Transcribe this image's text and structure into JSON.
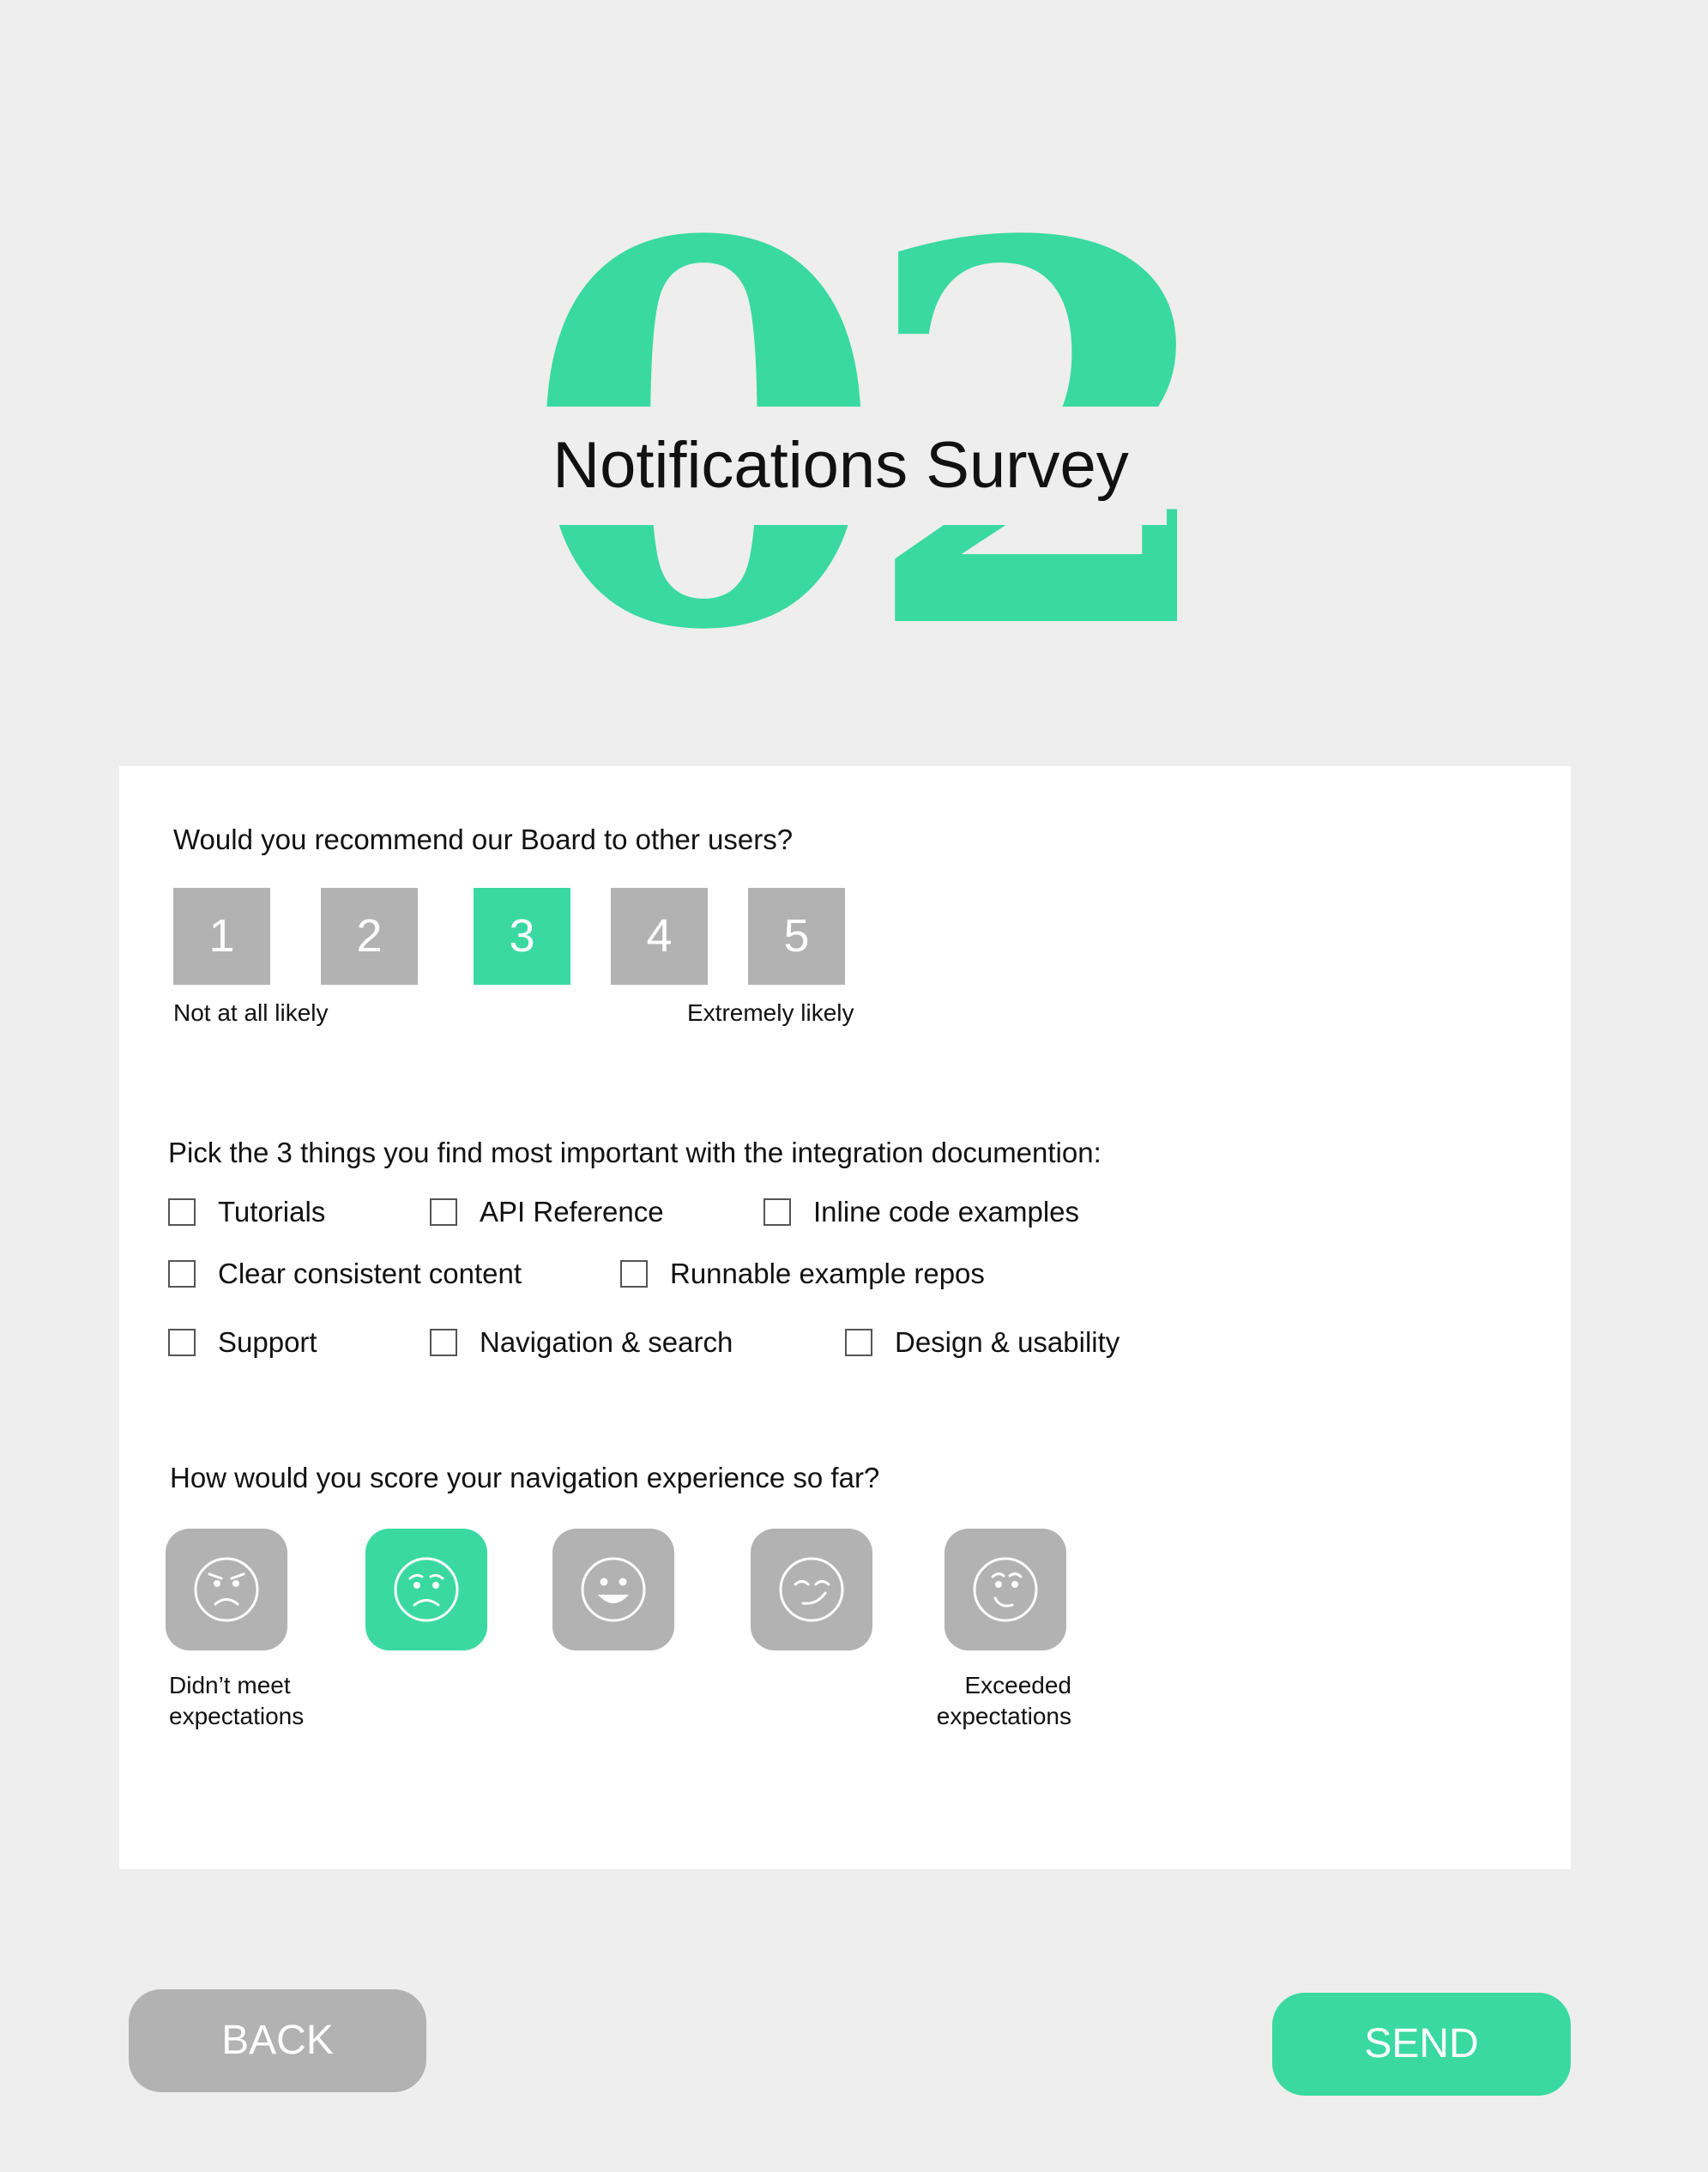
{
  "header": {
    "step_number": "02",
    "title": "Notifications Survey"
  },
  "colors": {
    "accent": "#3ad9a2",
    "inactive": "#b2b2b2",
    "background": "#eeeeee",
    "card": "#ffffff"
  },
  "question1": {
    "text": "Would you recommend our Board to other users?",
    "options": [
      "1",
      "2",
      "3",
      "4",
      "5"
    ],
    "selected": "3",
    "low_label": "Not at all likely",
    "high_label": "Extremely likely"
  },
  "question2": {
    "text": "Pick the 3 things you find most important with the integration documention:",
    "options": [
      {
        "label": "Tutorials",
        "checked": false
      },
      {
        "label": "API Reference",
        "checked": false
      },
      {
        "label": "Inline code examples",
        "checked": false
      },
      {
        "label": "Clear consistent content",
        "checked": false
      },
      {
        "label": "Runnable example repos",
        "checked": false
      },
      {
        "label": "Support",
        "checked": false
      },
      {
        "label": "Navigation & search",
        "checked": false
      },
      {
        "label": "Design & usability",
        "checked": false
      }
    ]
  },
  "question3": {
    "text": "How would you score your navigation experience so far?",
    "faces": [
      "angry-face-icon",
      "worried-face-icon",
      "smiling-face-icon",
      "winking-face-icon",
      "delighted-face-icon"
    ],
    "selected_index": 1,
    "low_label_line1": "Didn’t meet",
    "low_label_line2": "expectations",
    "high_label_line1": "Exceeded",
    "high_label_line2": "expectations"
  },
  "footer": {
    "back_label": "BACK",
    "send_label": "SEND"
  }
}
